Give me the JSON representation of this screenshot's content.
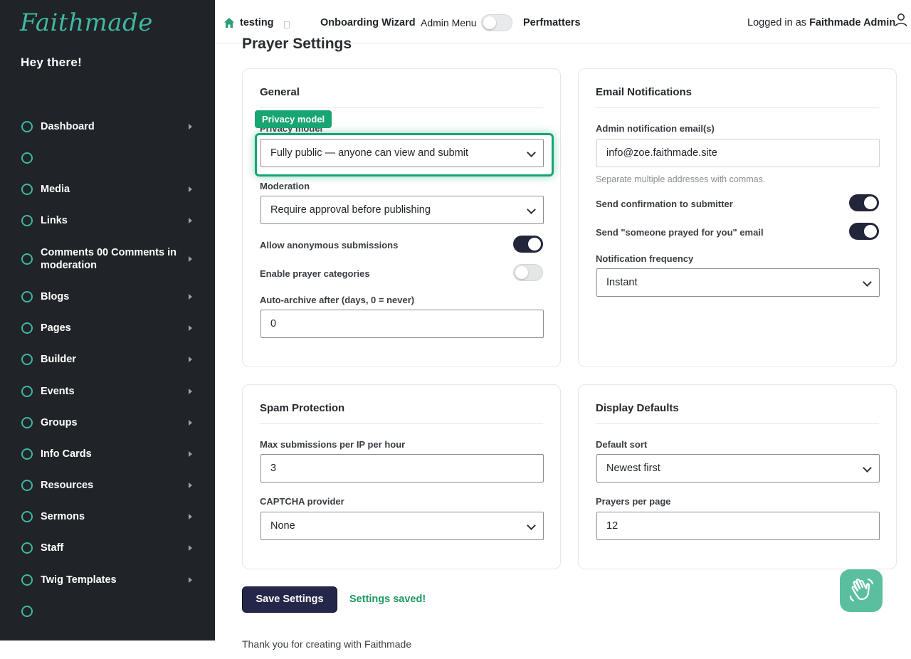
{
  "sidebar": {
    "logo": "Faithmade",
    "greeting": "Hey there!",
    "items": [
      {
        "label": "Dashboard",
        "arrow": true
      },
      {
        "label": "",
        "arrow": false
      },
      {
        "label": "Media",
        "arrow": true
      },
      {
        "label": "Links",
        "arrow": true
      },
      {
        "label": "Comments 00 Comments in moderation",
        "arrow": true
      },
      {
        "label": "Blogs",
        "arrow": true
      },
      {
        "label": "Pages",
        "arrow": true
      },
      {
        "label": "Builder",
        "arrow": true
      },
      {
        "label": "Events",
        "arrow": true
      },
      {
        "label": "Groups",
        "arrow": true
      },
      {
        "label": "Info Cards",
        "arrow": true
      },
      {
        "label": "Resources",
        "arrow": true
      },
      {
        "label": "Sermons",
        "arrow": true
      },
      {
        "label": "Staff",
        "arrow": true
      },
      {
        "label": "Twig Templates",
        "arrow": true
      },
      {
        "label": "",
        "arrow": false
      }
    ]
  },
  "topbar": {
    "site_name": "testing",
    "onboarding": "Onboarding Wizard",
    "admin_menu": "Admin Menu",
    "perfmatters": "Perfmatters",
    "logged_in_prefix": "Logged in as",
    "user_name": "Faithmade Admin"
  },
  "page": {
    "title": "Prayer Settings"
  },
  "general": {
    "title": "General",
    "privacy_label": "Privacy model",
    "privacy_value": "Fully public — anyone can view and submit",
    "moderation_label": "Moderation",
    "moderation_value": "Require approval before publishing",
    "anon_label": "Allow anonymous submissions",
    "categories_label": "Enable prayer categories",
    "archive_label": "Auto-archive after (days, 0 = never)",
    "archive_value": "0"
  },
  "email": {
    "title": "Email Notifications",
    "admin_email_label": "Admin notification email(s)",
    "admin_email_value": "info@zoe.faithmade.site",
    "helper": "Separate multiple addresses with commas.",
    "confirm_label": "Send confirmation to submitter",
    "prayed_label": "Send \"someone prayed for you\" email",
    "frequency_label": "Notification frequency",
    "frequency_value": "Instant"
  },
  "spam": {
    "title": "Spam Protection",
    "max_label": "Max submissions per IP per hour",
    "max_value": "3",
    "captcha_label": "CAPTCHA provider",
    "captcha_value": "None"
  },
  "display": {
    "title": "Display Defaults",
    "sort_label": "Default sort",
    "sort_value": "Newest first",
    "per_page_label": "Prayers per page",
    "per_page_value": "12"
  },
  "tooltip": "Privacy model",
  "actions": {
    "save": "Save Settings",
    "saved": "Settings saved!"
  },
  "footer": "Thank you for creating with Faithmade",
  "toggles": {
    "admin_menu": false,
    "anonymous": true,
    "categories": false,
    "confirmation": true,
    "prayed": true
  },
  "colors": {
    "accent": "#17a572",
    "sidebar_bg": "#202327",
    "primary_button": "#25274a"
  }
}
